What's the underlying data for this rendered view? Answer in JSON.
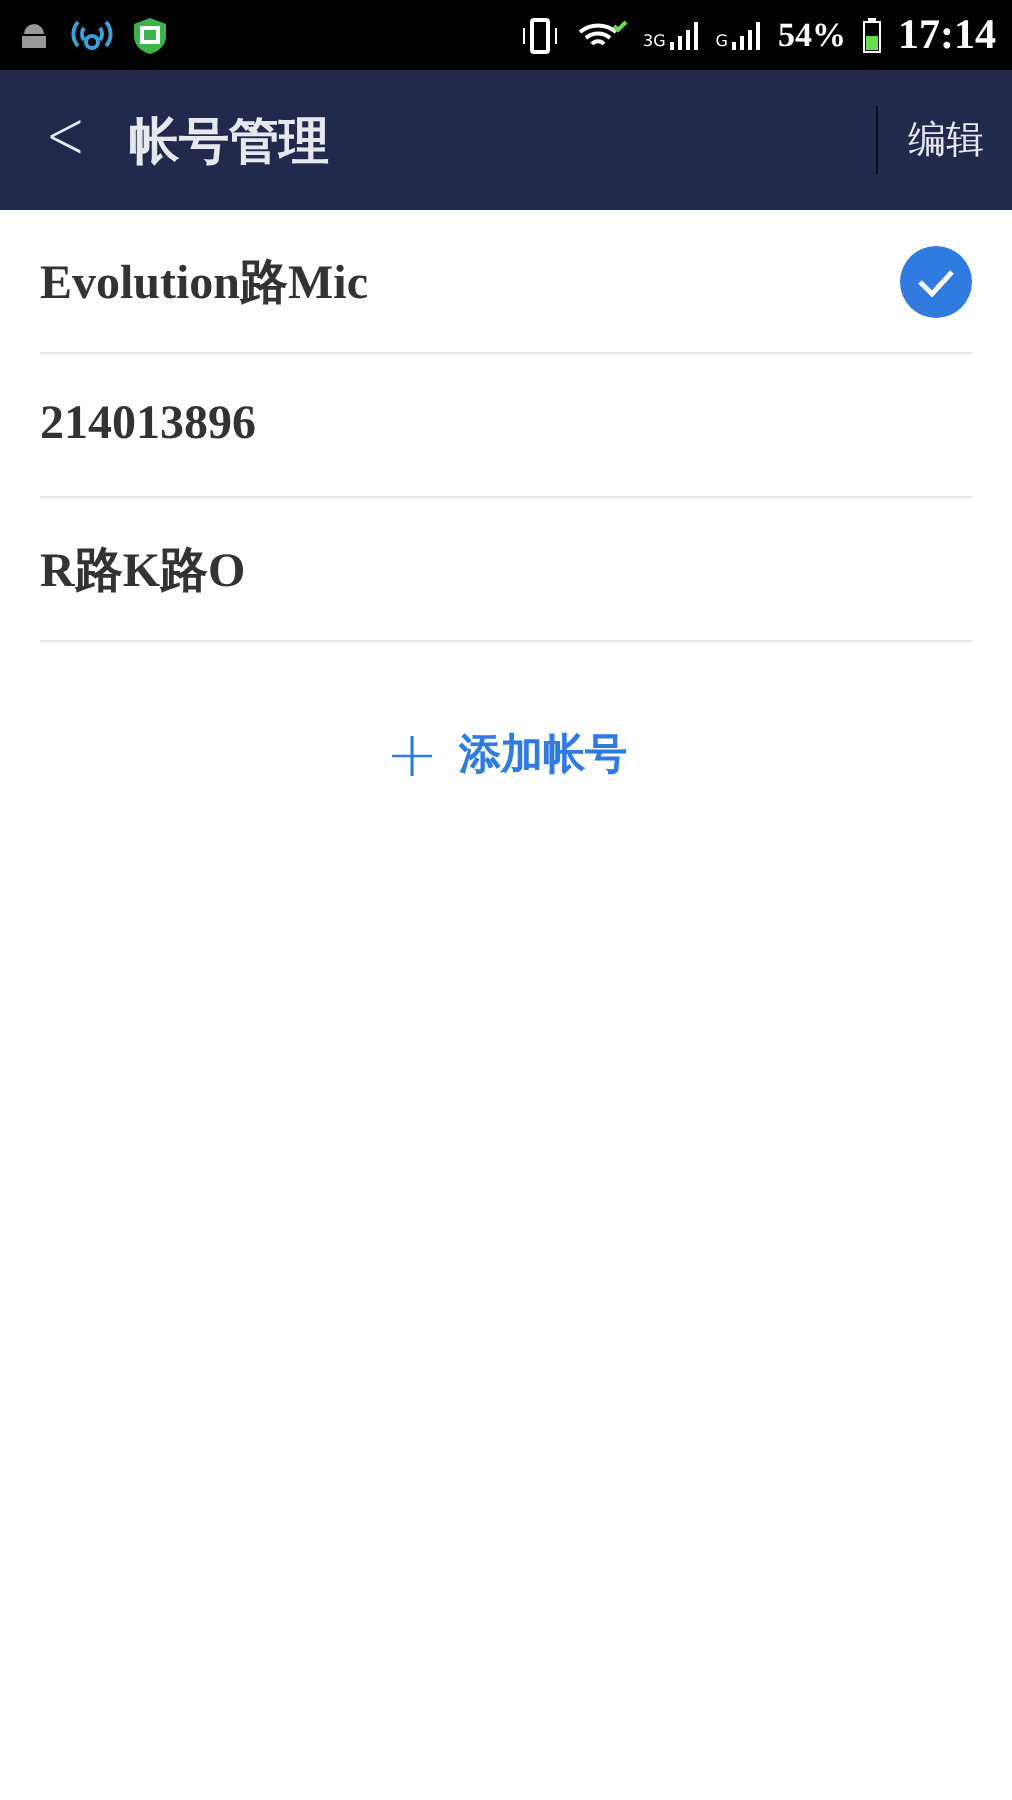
{
  "status_bar": {
    "network_3g": "3G",
    "network_g": "G",
    "battery": "54%",
    "time": "17:14"
  },
  "header": {
    "back": "<",
    "title": "帐号管理",
    "action": "编辑"
  },
  "accounts": [
    {
      "name": "Evolution路Mic",
      "selected": true
    },
    {
      "name": "214013896",
      "selected": false
    },
    {
      "name": "R路K路O",
      "selected": false
    }
  ],
  "add_button": {
    "icon": "+",
    "label": "添加帐号"
  }
}
